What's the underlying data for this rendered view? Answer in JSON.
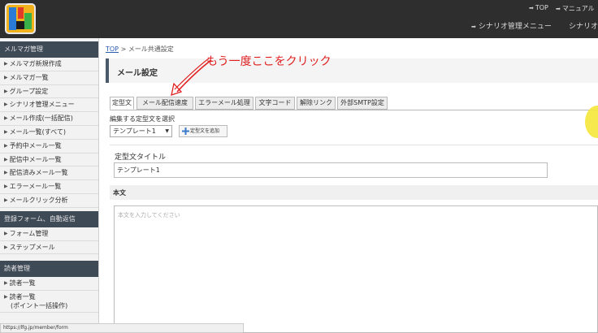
{
  "header": {
    "top_nav": [
      {
        "label": "TOP"
      },
      {
        "label": "マニュアル"
      }
    ],
    "main_nav": [
      {
        "label": "シナリオ管理メニュー"
      },
      {
        "label": "シナリオ"
      }
    ]
  },
  "sidebar": {
    "sections": [
      {
        "heading": "メルマガ管理",
        "items": [
          "メルマガ新規作成",
          "メルマガ一覧",
          "グループ設定",
          "シナリオ管理メニュー",
          "メール作成(一括配信)",
          "メール一覧(すべて)",
          "予約中メール一覧",
          "配信中メール一覧",
          "配信済みメール一覧",
          "エラーメール一覧",
          "メールクリック分析"
        ]
      },
      {
        "heading": "登録フォーム、自動返信",
        "items": [
          "フォーム管理",
          "ステップメール"
        ]
      },
      {
        "heading": "読者管理",
        "items": [
          "読者一覧"
        ],
        "tall_item": {
          "line1": "読者一覧",
          "line2": "(ポイント一括操作)"
        }
      }
    ]
  },
  "breadcrumb": {
    "home": "TOP",
    "separator": ">",
    "current": "メール共通設定"
  },
  "page_title": "メール設定",
  "annotation": {
    "text": "もう一度ここをクリック",
    "color": "#e02020"
  },
  "tabs": [
    {
      "label": "定型文",
      "active": true
    },
    {
      "label": "メール配信速度",
      "active": false
    },
    {
      "label": "エラーメール処理",
      "active": false
    },
    {
      "label": "文字コード",
      "active": false
    },
    {
      "label": "解除リンク",
      "active": false
    },
    {
      "label": "外部SMTP設定",
      "active": false
    }
  ],
  "template_select": {
    "label": "編集する定型文を選択",
    "value": "テンプレート1",
    "add_button": "定型文を追加"
  },
  "template_title": {
    "label": "定型文タイトル",
    "value": "テンプレート1"
  },
  "body": {
    "label": "本文",
    "placeholder": "本文を入力してください"
  },
  "status_url": "https://lfg.jp/member/form",
  "colors": {
    "header_bg": "#2e2e2e",
    "sidebar_heading_bg": "#3f4a57",
    "accent_red": "#e02020",
    "link_blue": "#2a5db0"
  }
}
